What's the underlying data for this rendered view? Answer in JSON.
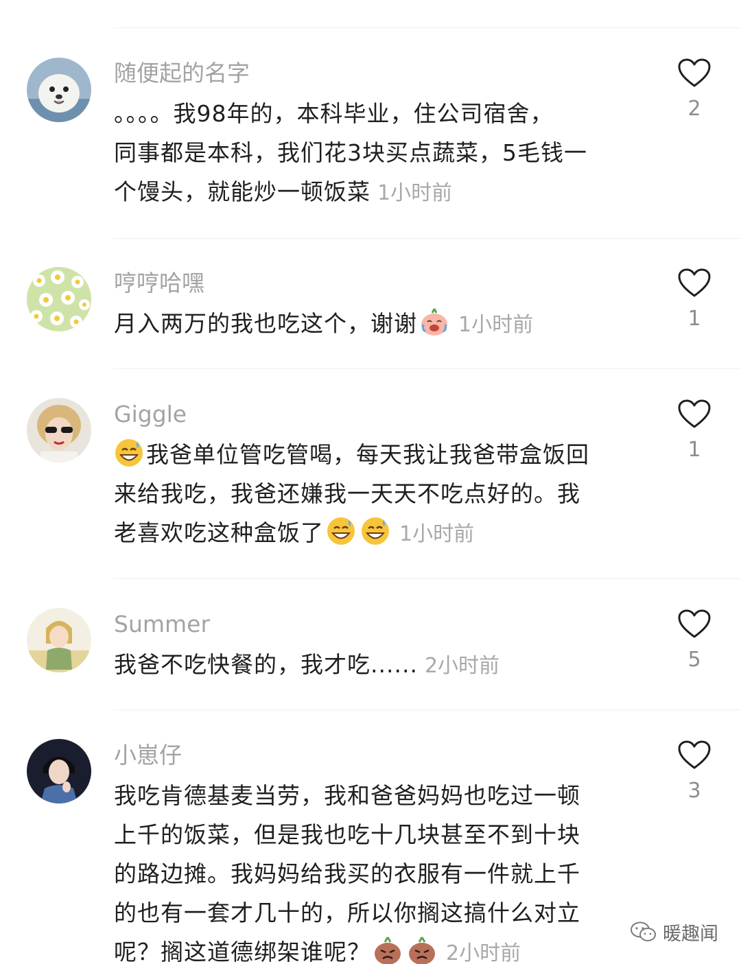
{
  "comments": [
    {
      "username": "随便起的名字",
      "avatar": "seal-avatar",
      "lines": [
        "。。。。我98年的，本科毕业，住公司宿舍，",
        "同事都是本科，我们花3块买点蔬菜，5毛钱一",
        "个馒头，就能炒一顿饭菜"
      ],
      "time": "1小时前",
      "likes": "2"
    },
    {
      "username": "哼哼哈嘿",
      "avatar": "daisy-flowers-avatar",
      "lines": [
        "月入两万的我也吃这个，谢谢"
      ],
      "emojis": [
        "crying-laughing-emoji"
      ],
      "time": "1小时前",
      "likes": "1"
    },
    {
      "username": "Giggle",
      "avatar": "woman-sunglasses-avatar",
      "lines": [
        "我爸单位管吃管喝，每天我让我爸带盒饭回",
        "来给我吃，我爸还嫌我一天天不吃点好的。我",
        "老喜欢吃这种盒饭了"
      ],
      "emojis": [
        "sweat-smile-emoji"
      ],
      "time": "1小时前",
      "likes": "1"
    },
    {
      "username": "Summer",
      "avatar": "anime-character-avatar",
      "lines": [
        "我爸不吃快餐的，我才吃......"
      ],
      "time": "2小时前",
      "likes": "5"
    },
    {
      "username": "小崽仔",
      "avatar": "man-portrait-avatar",
      "lines": [
        "我吃肯德基麦当劳，我和爸爸妈妈也吃过一顿",
        "上千的饭菜，但是我也吃十几块甚至不到十块",
        "的路边摊。我妈妈给我买的衣服有一件就上千",
        "的也有一套才几十的，所以你搁这搞什么对立",
        "呢？搁这道德绑架谁呢？"
      ],
      "emojis": [
        "angry-sprout-emoji"
      ],
      "time": "2小时前",
      "likes": "3"
    }
  ],
  "watermark": {
    "icon": "wechat-icon",
    "text": "暖趣闻"
  },
  "colors": {
    "username": "#a3a3a3",
    "text": "#1f1f1f",
    "time": "#a8a8a8",
    "divider": "#efefef"
  }
}
